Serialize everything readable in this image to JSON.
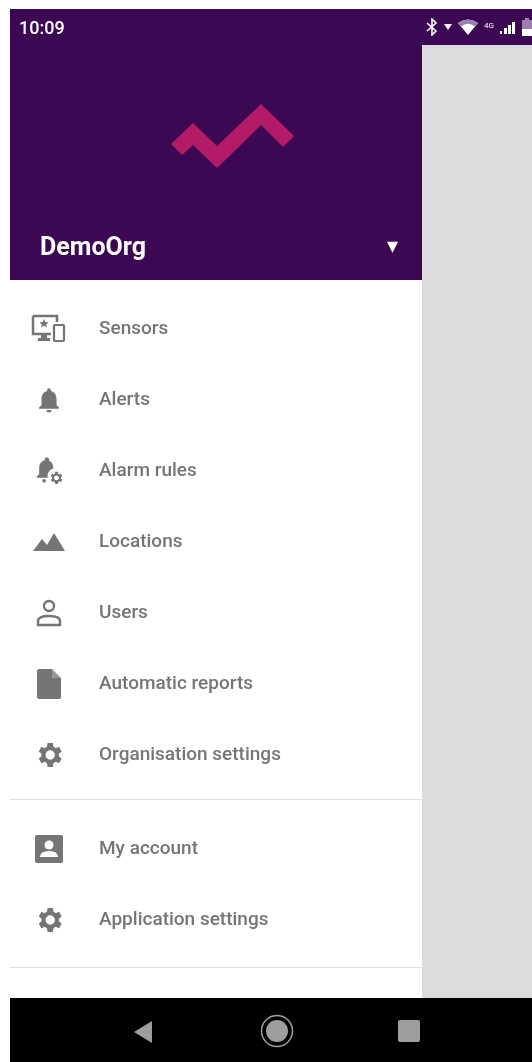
{
  "status_bar": {
    "time": "10:09",
    "network": "4G"
  },
  "header": {
    "organisation": "DemoOrg",
    "dropdown": "▾"
  },
  "sections": [
    {
      "items": [
        {
          "label": "Sensors"
        },
        {
          "label": "Alerts"
        },
        {
          "label": "Alarm rules"
        },
        {
          "label": "Locations"
        },
        {
          "label": "Users"
        },
        {
          "label": "Automatic reports"
        },
        {
          "label": "Organisation settings"
        }
      ]
    },
    {
      "items": [
        {
          "label": "My account"
        },
        {
          "label": "Application settings"
        }
      ]
    }
  ]
}
